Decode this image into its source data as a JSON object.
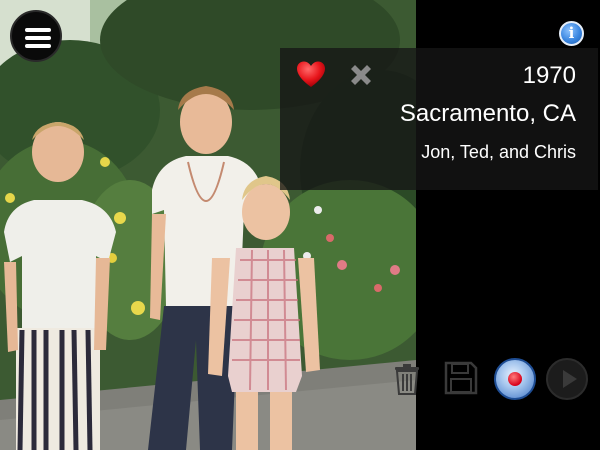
{
  "photo": {
    "subject": "three boys"
  },
  "info": {
    "year": "1970",
    "place": "Sacramento, CA",
    "people": "Jon, Ted, and Chris"
  },
  "icons": {
    "menu": "menu-icon",
    "heart": "heart-icon",
    "close": "close-icon",
    "info": "info-icon",
    "trash": "trash-icon",
    "save": "save-icon",
    "record": "record-icon",
    "play": "play-icon"
  },
  "colors": {
    "heart": "#e8161c",
    "record": "#d8001a",
    "info": "#3a86e0",
    "banner": "#161616"
  }
}
